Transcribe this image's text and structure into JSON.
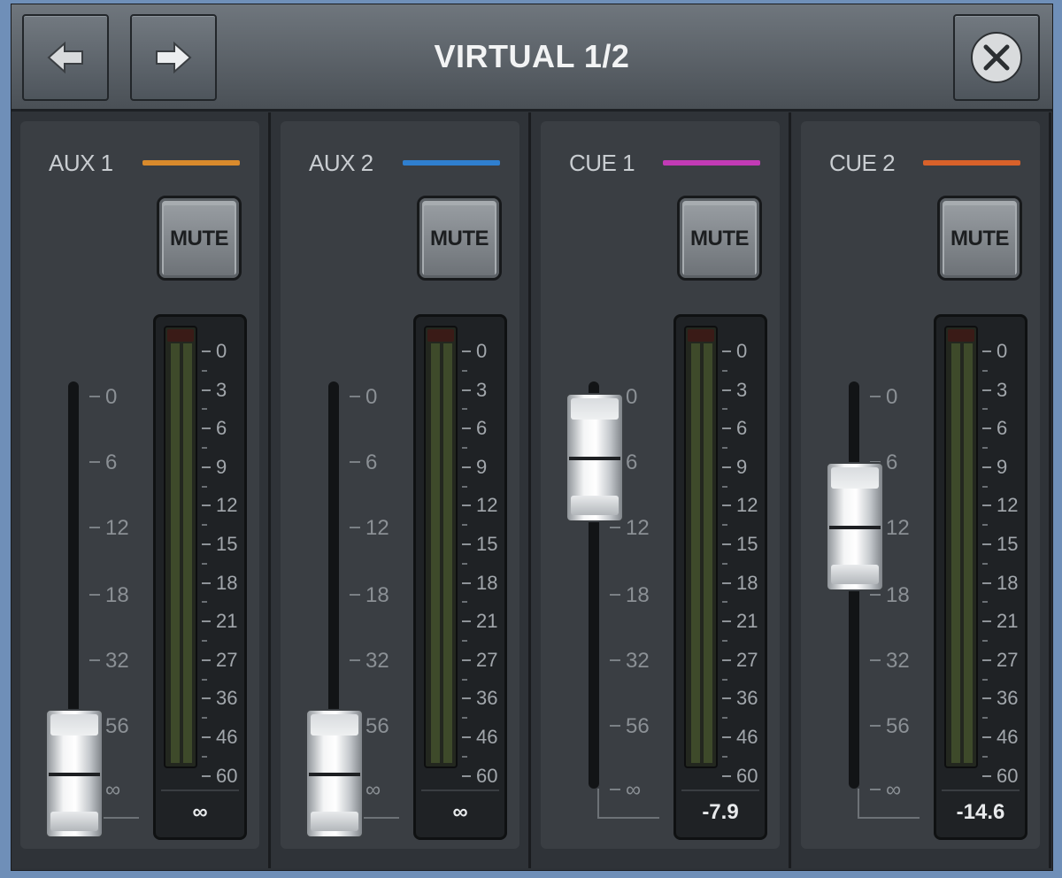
{
  "window": {
    "title": "VIRTUAL 1/2",
    "back_icon": "arrow-left-icon",
    "forward_icon": "arrow-right-icon",
    "close_icon": "close-circle-icon"
  },
  "fader_scale": [
    "0",
    "6",
    "12",
    "18",
    "32",
    "56",
    "∞"
  ],
  "meter_scale": [
    "0",
    "3",
    "6",
    "9",
    "12",
    "15",
    "18",
    "21",
    "27",
    "36",
    "46",
    "60"
  ],
  "channels": [
    {
      "name": "AUX 1",
      "color": "#d98a2c",
      "mute_label": "MUTE",
      "readout": "∞",
      "fader_position": 0.0
    },
    {
      "name": "AUX 2",
      "color": "#2f7fcf",
      "mute_label": "MUTE",
      "readout": "∞",
      "fader_position": 0.0
    },
    {
      "name": "CUE 1",
      "color": "#c23ab5",
      "mute_label": "MUTE",
      "readout": "-7.9",
      "fader_position": 0.87
    },
    {
      "name": "CUE 2",
      "color": "#d8612a",
      "mute_label": "MUTE",
      "readout": "-14.6",
      "fader_position": 0.68
    }
  ]
}
